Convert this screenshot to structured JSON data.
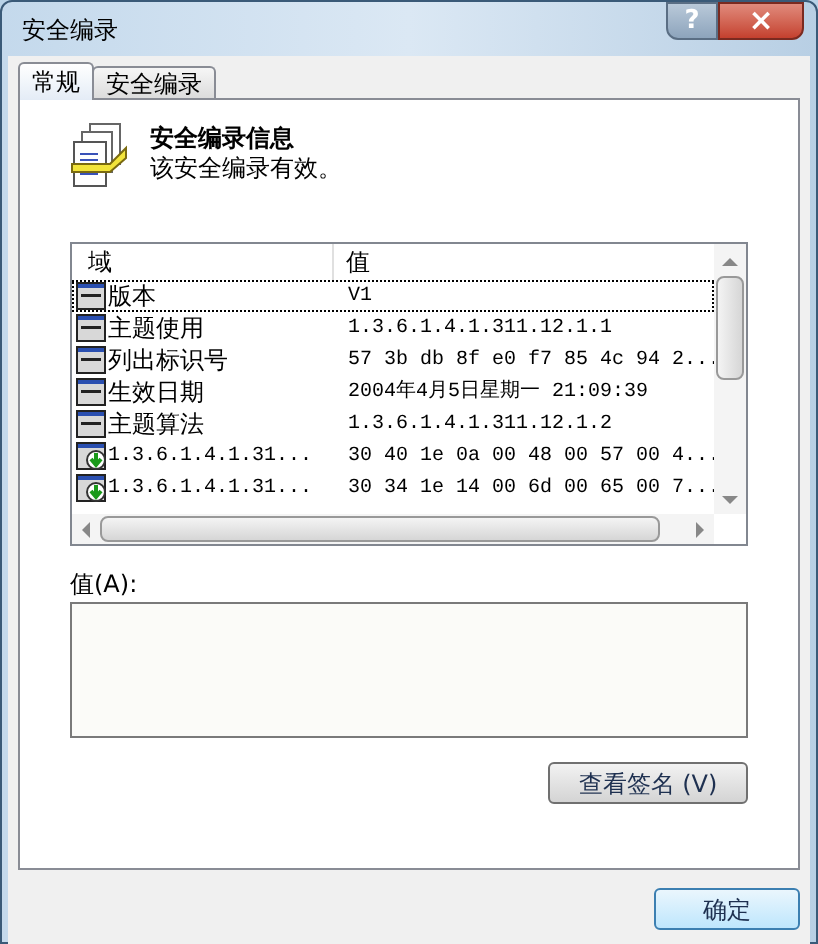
{
  "window": {
    "title": "安全编录",
    "help": "?",
    "close": "×"
  },
  "tabs": [
    {
      "label": "常规",
      "selected": true
    },
    {
      "label": "安全编录",
      "selected": false
    }
  ],
  "header": {
    "title": "安全编录信息",
    "subtitle": "该安全编录有效。"
  },
  "list": {
    "columns": [
      "域",
      "值"
    ],
    "rows": [
      {
        "kind": "field",
        "field": "版本",
        "value": "V1",
        "selected": true
      },
      {
        "kind": "field",
        "field": "主题使用",
        "value": "1.3.6.1.4.1.311.12.1.1",
        "selected": false
      },
      {
        "kind": "field",
        "field": "列出标识号",
        "value": "57 3b db 8f e0 f7 85 4c 94 2...",
        "selected": false
      },
      {
        "kind": "field",
        "field": "生效日期",
        "value": "2004年4月5日星期一 21:09:39",
        "selected": false
      },
      {
        "kind": "field",
        "field": "主题算法",
        "value": "1.3.6.1.4.1.311.12.1.2",
        "selected": false
      },
      {
        "kind": "extension",
        "field": "1.3.6.1.4.1.31...",
        "value": "30 40 1e 0a 00 48 00 57 00 4...",
        "selected": false
      },
      {
        "kind": "extension",
        "field": "1.3.6.1.4.1.31...",
        "value": "30 34 1e 14 00 6d 00 65 00 7...",
        "selected": false
      }
    ]
  },
  "value_label": "值(A):",
  "view_signature_button": "查看签名 (V)",
  "ok_button": "确定"
}
